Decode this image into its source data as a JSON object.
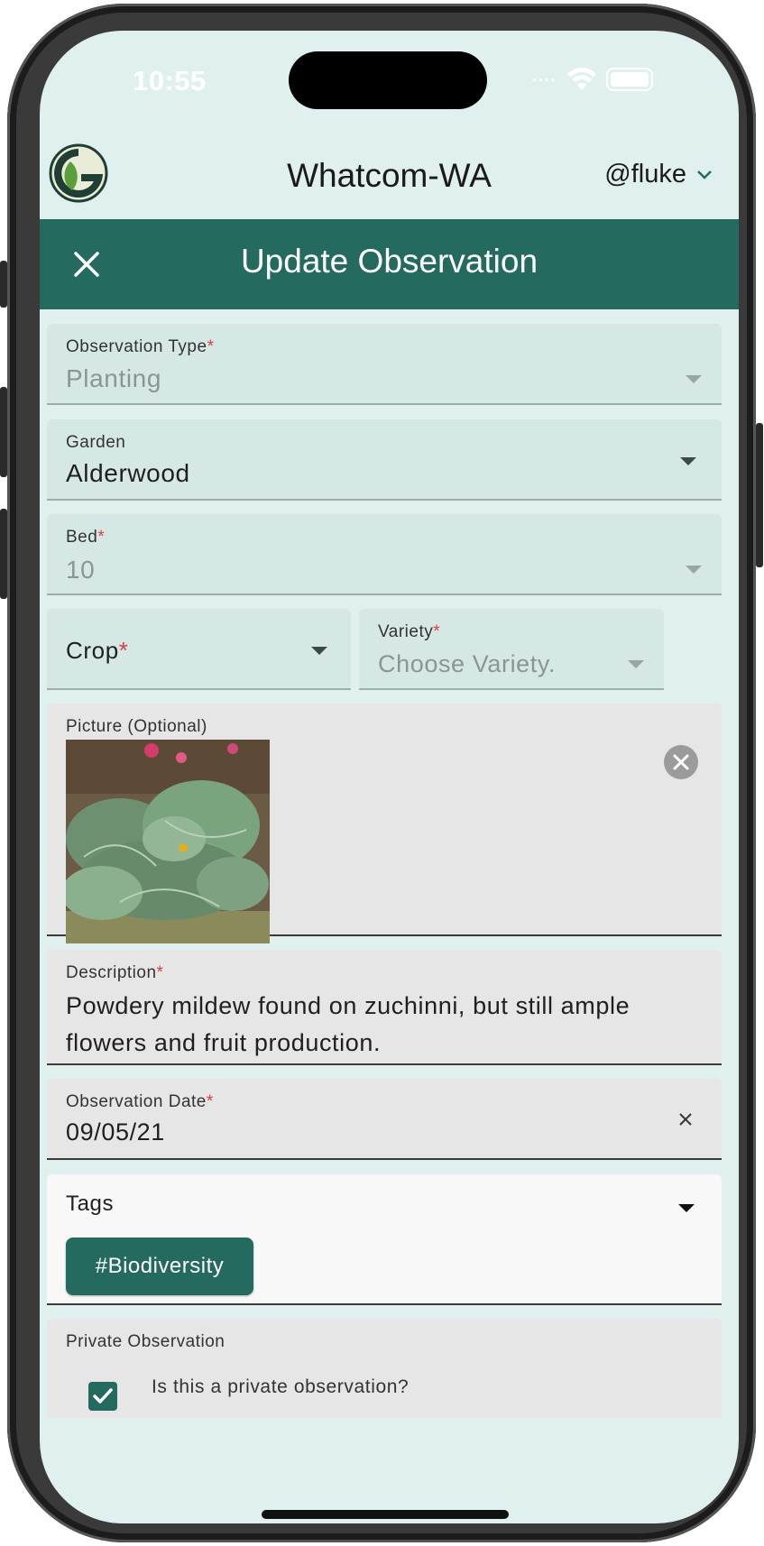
{
  "status_bar": {
    "time": "10:55"
  },
  "header": {
    "title": "Whatcom-WA",
    "user": "@fluke"
  },
  "modal": {
    "title": "Update Observation"
  },
  "form": {
    "observation_type": {
      "label": "Observation Type",
      "value": "Planting"
    },
    "garden": {
      "label": "Garden",
      "value": "Alderwood"
    },
    "bed": {
      "label": "Bed",
      "value": "10"
    },
    "crop": {
      "label": "Crop"
    },
    "variety": {
      "label": "Variety",
      "placeholder": "Choose Variety."
    },
    "picture": {
      "label": "Picture (Optional)"
    },
    "description": {
      "label": "Description",
      "value": "Powdery mildew found on zuchinni, but still ample flowers and fruit production."
    },
    "observation_date": {
      "label": "Observation Date",
      "value": "09/05/21"
    },
    "tags": {
      "label": "Tags",
      "items": [
        "#Biodiversity"
      ]
    },
    "private": {
      "label": "Private Observation",
      "question": "Is this a private observation?",
      "checked": true
    }
  },
  "required_marker": "*",
  "colors": {
    "primary": "#246a5f",
    "background": "#dff0ef",
    "required": "#d94040"
  }
}
